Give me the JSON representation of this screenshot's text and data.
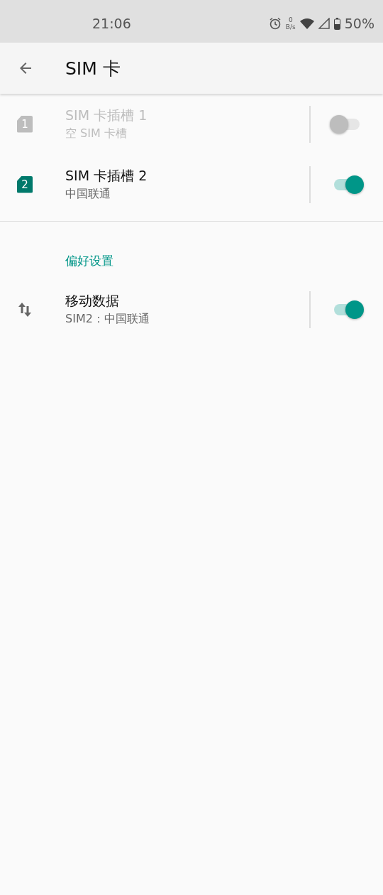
{
  "status_bar": {
    "time": "21:06",
    "net_speed": {
      "value": "0",
      "unit": "B/s"
    },
    "battery": "50%"
  },
  "toolbar": {
    "title": "SIM 卡"
  },
  "sim_slots": [
    {
      "kind": "sim",
      "badge": "1",
      "title": "SIM 卡插槽 1",
      "subtitle": "空 SIM 卡槽",
      "disabled": true,
      "on": false
    },
    {
      "kind": "sim",
      "badge": "2",
      "title": "SIM 卡插槽 2",
      "subtitle": "中国联通",
      "disabled": false,
      "on": true
    }
  ],
  "preferences": {
    "header": "偏好设置",
    "items": [
      {
        "kind": "data",
        "title": "移动数据",
        "subtitle": "SIM2：中国联通",
        "disabled": false,
        "on": true
      }
    ]
  }
}
